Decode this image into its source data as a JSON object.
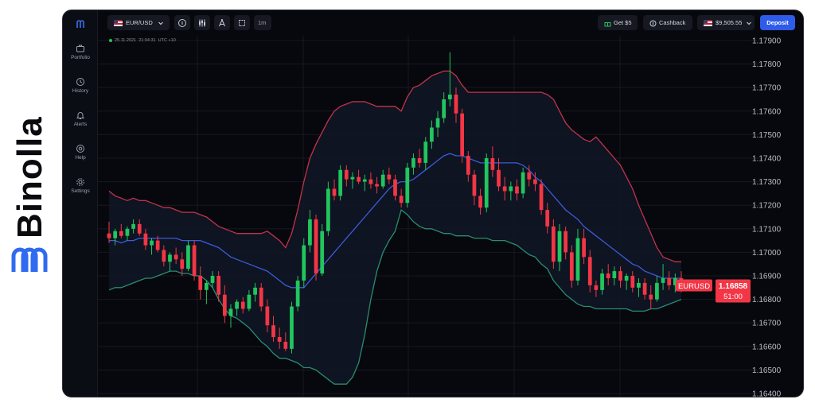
{
  "brand": {
    "name": "Binolla"
  },
  "nav": {
    "items": [
      {
        "label": "Portfolio",
        "icon": "briefcase-icon"
      },
      {
        "label": "History",
        "icon": "history-icon"
      },
      {
        "label": "Alerts",
        "icon": "bell-icon"
      },
      {
        "label": "Help",
        "icon": "help-icon"
      },
      {
        "label": "Settings",
        "icon": "gear-icon"
      }
    ]
  },
  "toolbar": {
    "asset": "EUR/USD",
    "timeframe": "1m",
    "get_bonus": "Get $5",
    "cashback": "Cashback",
    "balance": "$9,505.55",
    "deposit": "Deposit"
  },
  "chart_info": {
    "datetime": "25.11.2021",
    "time": "21:04:31",
    "timezone": "UTC +10"
  },
  "price_label": {
    "symbol": "EURUSD",
    "price": "1.16858",
    "countdown": "51:00"
  },
  "colors": {
    "up": "#22c55e",
    "down": "#f23645",
    "middle_band": "#3b5bdb",
    "upper_band": "#c2334a",
    "lower_band": "#2a8c6f",
    "accent": "#2f5bea"
  },
  "chart_data": {
    "type": "candlestick",
    "y_ticks": [
      "1.17900",
      "1.17800",
      "1.17700",
      "1.17600",
      "1.17500",
      "1.17400",
      "1.17300",
      "1.17200",
      "1.17100",
      "1.17000",
      "1.16900",
      "1.16800",
      "1.16700",
      "1.16600",
      "1.16500",
      "1.16400"
    ],
    "ylim": [
      1.1638,
      1.1792
    ],
    "candles": [
      [
        1.1708,
        1.1713,
        1.1704,
        1.1706
      ],
      [
        1.1706,
        1.171,
        1.1703,
        1.1709
      ],
      [
        1.1709,
        1.1712,
        1.1706,
        1.1707
      ],
      [
        1.1707,
        1.1711,
        1.1705,
        1.171
      ],
      [
        1.171,
        1.1714,
        1.1708,
        1.1712
      ],
      [
        1.1712,
        1.1714,
        1.1707,
        1.1708
      ],
      [
        1.1708,
        1.171,
        1.1701,
        1.1703
      ],
      [
        1.1703,
        1.1706,
        1.1699,
        1.1705
      ],
      [
        1.1705,
        1.1707,
        1.17,
        1.1701
      ],
      [
        1.1701,
        1.1703,
        1.1694,
        1.1696
      ],
      [
        1.1696,
        1.17,
        1.1692,
        1.1699
      ],
      [
        1.1699,
        1.1702,
        1.1695,
        1.1697
      ],
      [
        1.1697,
        1.17,
        1.169,
        1.1693
      ],
      [
        1.1693,
        1.1705,
        1.1692,
        1.1703
      ],
      [
        1.1703,
        1.1705,
        1.1688,
        1.169
      ],
      [
        1.169,
        1.1694,
        1.168,
        1.1684
      ],
      [
        1.1684,
        1.1688,
        1.1678,
        1.1687
      ],
      [
        1.1687,
        1.1692,
        1.1685,
        1.169
      ],
      [
        1.169,
        1.1692,
        1.1679,
        1.1682
      ],
      [
        1.1682,
        1.1686,
        1.167,
        1.1673
      ],
      [
        1.1673,
        1.1678,
        1.1668,
        1.1676
      ],
      [
        1.1676,
        1.168,
        1.1673,
        1.1679
      ],
      [
        1.1679,
        1.1681,
        1.1674,
        1.1676
      ],
      [
        1.1676,
        1.1684,
        1.1675,
        1.1682
      ],
      [
        1.1682,
        1.1687,
        1.1679,
        1.1685
      ],
      [
        1.1685,
        1.1687,
        1.1675,
        1.1677
      ],
      [
        1.1677,
        1.168,
        1.1666,
        1.1669
      ],
      [
        1.1669,
        1.1673,
        1.1662,
        1.1664
      ],
      [
        1.1664,
        1.1668,
        1.1659,
        1.1662
      ],
      [
        1.1662,
        1.1666,
        1.1658,
        1.1659
      ],
      [
        1.1659,
        1.1679,
        1.1657,
        1.1677
      ],
      [
        1.1677,
        1.169,
        1.1675,
        1.1688
      ],
      [
        1.1688,
        1.1706,
        1.1685,
        1.1703
      ],
      [
        1.1703,
        1.1718,
        1.17,
        1.1714
      ],
      [
        1.1714,
        1.1716,
        1.1688,
        1.1691
      ],
      [
        1.1691,
        1.1712,
        1.169,
        1.1709
      ],
      [
        1.1709,
        1.173,
        1.1707,
        1.1727
      ],
      [
        1.1727,
        1.1731,
        1.1722,
        1.1724
      ],
      [
        1.1724,
        1.1737,
        1.1722,
        1.1735
      ],
      [
        1.1735,
        1.1737,
        1.1728,
        1.1731
      ],
      [
        1.1731,
        1.1734,
        1.1727,
        1.1732
      ],
      [
        1.1732,
        1.1735,
        1.1729,
        1.173
      ],
      [
        1.173,
        1.1733,
        1.1726,
        1.1731
      ],
      [
        1.1731,
        1.1734,
        1.1727,
        1.1729
      ],
      [
        1.1729,
        1.1732,
        1.1725,
        1.1728
      ],
      [
        1.1728,
        1.1735,
        1.1727,
        1.1733
      ],
      [
        1.1733,
        1.1736,
        1.1729,
        1.1731
      ],
      [
        1.1731,
        1.1733,
        1.1722,
        1.1724
      ],
      [
        1.1724,
        1.1727,
        1.1719,
        1.1721
      ],
      [
        1.1721,
        1.1738,
        1.1719,
        1.1736
      ],
      [
        1.1736,
        1.1742,
        1.1733,
        1.174
      ],
      [
        1.174,
        1.1744,
        1.1736,
        1.1738
      ],
      [
        1.1738,
        1.1749,
        1.1735,
        1.1747
      ],
      [
        1.1747,
        1.1756,
        1.1744,
        1.1753
      ],
      [
        1.1753,
        1.176,
        1.1749,
        1.1757
      ],
      [
        1.1757,
        1.1768,
        1.1755,
        1.1765
      ],
      [
        1.1765,
        1.1785,
        1.1762,
        1.1767
      ],
      [
        1.1767,
        1.177,
        1.1755,
        1.1759
      ],
      [
        1.1759,
        1.1761,
        1.1738,
        1.1741
      ],
      [
        1.1741,
        1.1743,
        1.173,
        1.1733
      ],
      [
        1.1733,
        1.1735,
        1.172,
        1.1724
      ],
      [
        1.1724,
        1.1727,
        1.1716,
        1.1719
      ],
      [
        1.1719,
        1.1742,
        1.1717,
        1.174
      ],
      [
        1.174,
        1.1745,
        1.1732,
        1.1735
      ],
      [
        1.1735,
        1.174,
        1.1726,
        1.1728
      ],
      [
        1.1728,
        1.1732,
        1.1722,
        1.1726
      ],
      [
        1.1726,
        1.173,
        1.1722,
        1.1728
      ],
      [
        1.1728,
        1.1731,
        1.1722,
        1.1725
      ],
      [
        1.1725,
        1.1736,
        1.1723,
        1.1734
      ],
      [
        1.1734,
        1.1737,
        1.1728,
        1.1731
      ],
      [
        1.1731,
        1.1734,
        1.1726,
        1.1729
      ],
      [
        1.1729,
        1.1731,
        1.1716,
        1.1718
      ],
      [
        1.1718,
        1.1721,
        1.1708,
        1.1711
      ],
      [
        1.1711,
        1.1714,
        1.1693,
        1.1696
      ],
      [
        1.1696,
        1.1712,
        1.1692,
        1.1709
      ],
      [
        1.1709,
        1.1711,
        1.1697,
        1.17
      ],
      [
        1.17,
        1.1703,
        1.1685,
        1.1688
      ],
      [
        1.1688,
        1.171,
        1.1686,
        1.1706
      ],
      [
        1.1706,
        1.171,
        1.1695,
        1.1698
      ],
      [
        1.1698,
        1.1701,
        1.1683,
        1.1686
      ],
      [
        1.1686,
        1.1688,
        1.1681,
        1.1684
      ],
      [
        1.1684,
        1.1693,
        1.1682,
        1.1691
      ],
      [
        1.1691,
        1.1695,
        1.1686,
        1.1689
      ],
      [
        1.1689,
        1.1694,
        1.1686,
        1.1692
      ],
      [
        1.1692,
        1.1694,
        1.1685,
        1.1688
      ],
      [
        1.1688,
        1.1691,
        1.1684,
        1.169
      ],
      [
        1.169,
        1.1692,
        1.1683,
        1.1685
      ],
      [
        1.1685,
        1.1689,
        1.1681,
        1.1687
      ],
      [
        1.1687,
        1.1689,
        1.168,
        1.1682
      ],
      [
        1.1682,
        1.1686,
        1.1676,
        1.168
      ],
      [
        1.168,
        1.169,
        1.1679,
        1.1687
      ],
      [
        1.1687,
        1.1695,
        1.1684,
        1.1689
      ],
      [
        1.1689,
        1.1692,
        1.1684,
        1.1686
      ],
      [
        1.1686,
        1.1691,
        1.1683,
        1.1689
      ],
      [
        1.1689,
        1.1692,
        1.1683,
        1.1686
      ]
    ],
    "bands": {
      "upper": [
        1.1726,
        1.1724,
        1.1723,
        1.1722,
        1.1723,
        1.1722,
        1.1722,
        1.1721,
        1.172,
        1.1719,
        1.1719,
        1.1718,
        1.1717,
        1.1717,
        1.1717,
        1.1716,
        1.1715,
        1.1713,
        1.1711,
        1.171,
        1.1709,
        1.1708,
        1.1708,
        1.1708,
        1.1708,
        1.1708,
        1.1709,
        1.1707,
        1.1705,
        1.1702,
        1.1708,
        1.1718,
        1.173,
        1.174,
        1.1746,
        1.1751,
        1.1756,
        1.176,
        1.1762,
        1.1763,
        1.1764,
        1.1764,
        1.1764,
        1.1763,
        1.1762,
        1.1762,
        1.1762,
        1.1762,
        1.176,
        1.1766,
        1.177,
        1.1771,
        1.1773,
        1.1775,
        1.1776,
        1.1777,
        1.1777,
        1.1775,
        1.1771,
        1.1768,
        1.1768,
        1.1768,
        1.1768,
        1.1768,
        1.1768,
        1.1768,
        1.1768,
        1.1768,
        1.1768,
        1.1768,
        1.1768,
        1.1768,
        1.1767,
        1.1765,
        1.176,
        1.1755,
        1.1752,
        1.175,
        1.1748,
        1.1747,
        1.1749,
        1.1746,
        1.1743,
        1.174,
        1.1737,
        1.1732,
        1.1727,
        1.172,
        1.1714,
        1.1708,
        1.1702,
        1.1698,
        1.1697,
        1.1696,
        1.1696
      ],
      "middle": [
        1.1705,
        1.1705,
        1.1704,
        1.1705,
        1.1705,
        1.1706,
        1.1706,
        1.1706,
        1.1706,
        1.1706,
        1.1706,
        1.1706,
        1.1705,
        1.1705,
        1.1705,
        1.1705,
        1.1704,
        1.1703,
        1.1702,
        1.17,
        1.1698,
        1.1697,
        1.1696,
        1.1695,
        1.1694,
        1.1693,
        1.1692,
        1.169,
        1.1688,
        1.1686,
        1.1685,
        1.1685,
        1.1685,
        1.1688,
        1.1691,
        1.1694,
        1.1697,
        1.17,
        1.1703,
        1.1706,
        1.1709,
        1.1712,
        1.1715,
        1.1718,
        1.1721,
        1.1724,
        1.1727,
        1.1729,
        1.173,
        1.173,
        1.1731,
        1.1733,
        1.1735,
        1.1737,
        1.1739,
        1.1741,
        1.1742,
        1.1741,
        1.1741,
        1.174,
        1.1739,
        1.1738,
        1.1738,
        1.1738,
        1.1738,
        1.1738,
        1.1738,
        1.1738,
        1.1737,
        1.1735,
        1.1732,
        1.173,
        1.1727,
        1.1724,
        1.1721,
        1.1718,
        1.1716,
        1.1714,
        1.1711,
        1.1709,
        1.1707,
        1.1705,
        1.1703,
        1.1701,
        1.1699,
        1.1697,
        1.1695,
        1.1694,
        1.1692,
        1.1691,
        1.169,
        1.1689,
        1.1689,
        1.1689,
        1.1689
      ],
      "lower": [
        1.1684,
        1.1685,
        1.1685,
        1.1686,
        1.1687,
        1.1688,
        1.1689,
        1.1689,
        1.169,
        1.1691,
        1.1692,
        1.1692,
        1.1691,
        1.1691,
        1.169,
        1.169,
        1.1688,
        1.1685,
        1.168,
        1.1676,
        1.1673,
        1.1672,
        1.167,
        1.1668,
        1.1665,
        1.1662,
        1.166,
        1.1657,
        1.1655,
        1.1655,
        1.1654,
        1.1653,
        1.1651,
        1.1651,
        1.165,
        1.1648,
        1.1646,
        1.1644,
        1.1644,
        1.1644,
        1.1647,
        1.1653,
        1.1665,
        1.168,
        1.1692,
        1.17,
        1.1705,
        1.1709,
        1.1718,
        1.1716,
        1.1713,
        1.1711,
        1.171,
        1.171,
        1.1709,
        1.1708,
        1.1708,
        1.1707,
        1.1707,
        1.1707,
        1.1706,
        1.1706,
        1.1706,
        1.1705,
        1.1705,
        1.1705,
        1.1704,
        1.1703,
        1.1701,
        1.1699,
        1.1698,
        1.1695,
        1.1693,
        1.1688,
        1.1685,
        1.1682,
        1.168,
        1.1678,
        1.1677,
        1.1677,
        1.1676,
        1.1676,
        1.1676,
        1.1676,
        1.1676,
        1.1676,
        1.1675,
        1.1675,
        1.1675,
        1.1676,
        1.1676,
        1.1677,
        1.1678,
        1.1679,
        1.168
      ]
    }
  }
}
